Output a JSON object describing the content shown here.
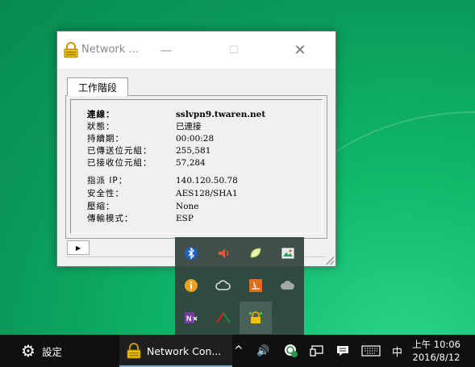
{
  "window": {
    "title": "Network ...",
    "minimize_glyph": "—",
    "maximize_glyph": "☐",
    "close_glyph": "✕",
    "tab_label": "工作階段",
    "expand_glyph": "▶",
    "rows": [
      {
        "label": "連線：",
        "value": "sslvpn9.twaren.net",
        "bold": true
      },
      {
        "label": "狀態：",
        "value": "已連接"
      },
      {
        "label": "持續期：",
        "value": "00:00:28"
      },
      {
        "label": "已傳送位元組：",
        "value": "255,581"
      },
      {
        "label": "已接收位元組：",
        "value": "57,284"
      },
      {
        "label": "指派 IP：",
        "value": "140.120.50.78"
      },
      {
        "label": "安全性：",
        "value": "AES128/SHA1"
      },
      {
        "label": "壓縮：",
        "value": "None"
      },
      {
        "label": "傳輸模式：",
        "value": "ESP"
      }
    ]
  },
  "tray_overflow": {
    "icons": [
      "bluetooth-icon",
      "speaker-icon",
      "leaf-app-icon",
      "photo-app-icon",
      "info-icon",
      "creative-cloud-icon",
      "java-icon",
      "cloud-icon",
      "onenote-icon",
      "antivirus-icon",
      "vpn-lock-icon"
    ]
  },
  "taskbar": {
    "settings_label": "設定",
    "app_label": "Network Con...",
    "tray_chevron": "^",
    "volume_glyph": "🔊",
    "ime_label": "中",
    "clock_time": "上午 10:06",
    "clock_date": "2016/8/12"
  },
  "colors": {
    "taskbar_bg": "#101010",
    "accent_underline": "#7aa7d8",
    "desktop_green": "#10b86a"
  }
}
